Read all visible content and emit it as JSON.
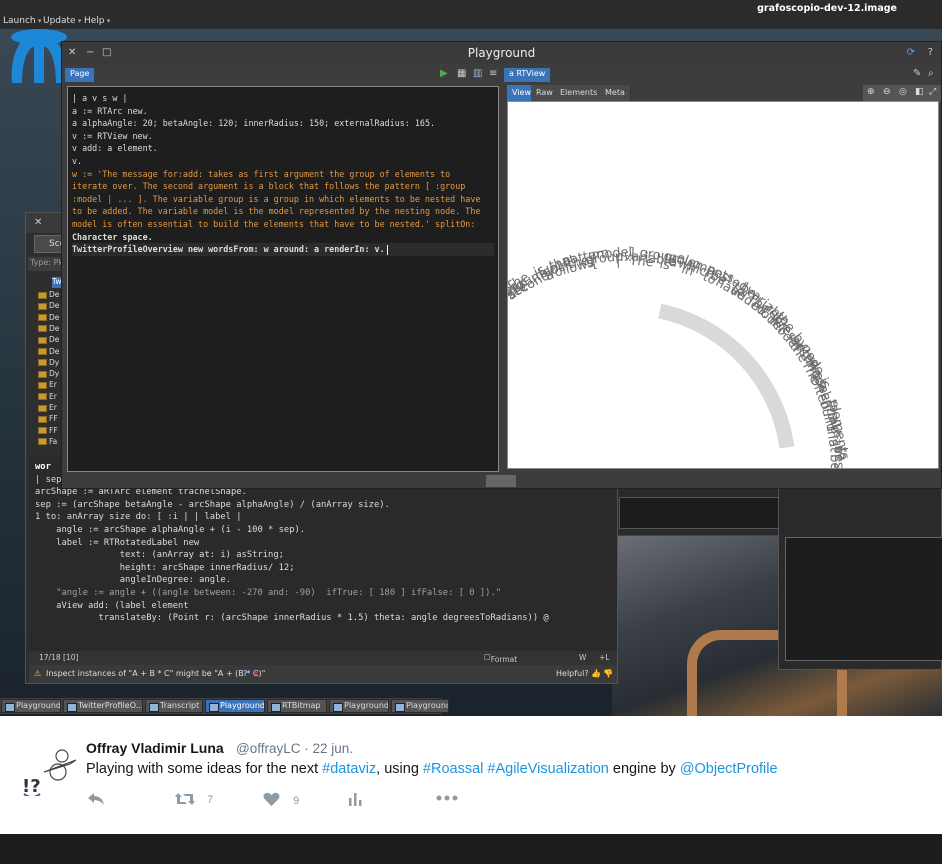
{
  "menubar": {
    "items": [
      "Launch",
      "Update",
      "Help"
    ],
    "image_name": "grafoscopio-dev-12.image"
  },
  "playground": {
    "title": "Playground",
    "left_tab": "Page",
    "right_tab": "a RTView",
    "view_tabs": [
      "View",
      "Raw",
      "Elements",
      "Meta"
    ],
    "code_lines": [
      "| a v s w |",
      "a := RTArc new.",
      "a alphaAngle: 20; betaAngle: 120; innerRadius: 150; externalRadius: 165.",
      "v := RTView new.",
      "v add: a element.",
      "v.",
      "w := 'The message for:add: takes as first argument the group of elements to",
      "iterate over. The second argument is a block that follows the pattern [ :group",
      ":model | ... ]. The variable group is a group in which elements to be nested have",
      "to be added. The variable model is the model represented by the nesting node. The",
      "model is often essential to build the elements that have to be nested.' splitOn:",
      "Character space.",
      "TwitterProfileOverview new wordsFrom: w around: a renderIn: v."
    ],
    "words": [
      "The",
      "message",
      "for:add:",
      "takes",
      "as",
      "first",
      "argument",
      "the",
      "group",
      "of",
      "elements",
      "to",
      "iterate",
      "over.",
      "The",
      "second",
      "argument",
      "is",
      "a",
      "block",
      "that",
      "follows",
      "the",
      "pattern",
      "[",
      ":group",
      ":model",
      "|",
      "...",
      "].",
      "The",
      "variable",
      "group",
      "is",
      "a",
      "group",
      "in",
      "which",
      "elements",
      "to",
      "be",
      "nested",
      "have",
      "to",
      "be",
      "added.",
      "The",
      "variable",
      "model",
      "is",
      "the",
      "model",
      "represented",
      "by",
      "the",
      "nesting",
      "node.",
      "The",
      "model",
      "is",
      "often",
      "essential",
      "to",
      "build",
      "the",
      "elements",
      "that",
      "have",
      "to",
      "be",
      "nested."
    ],
    "arc": {
      "alpha_angle": 20,
      "beta_angle": 120,
      "inner_radius": 150,
      "external_radius": 165
    }
  },
  "browser": {
    "scope_button": "Scop",
    "filter_placeholder": "Type: Pk",
    "selected_item": "Tw",
    "packages": [
      "De",
      "De",
      "De",
      "De",
      "De",
      "De",
      "Dy",
      "Dy",
      "Er",
      "Er",
      "Er",
      "FF",
      "FF",
      "Fa"
    ],
    "method_name": "wor",
    "code_lines": [
      "| sep arcShape angle |",
      "",
      "arcShape := aRTArc element trachelShape.",
      "sep := (arcShape betaAngle - arcShape alphaAngle) / (anArray size).",
      "1 to: anArray size do: [ :i | | label |",
      "    angle := arcShape alphaAngle + (i - 100 * sep).",
      "    label := RTRotatedLabel new",
      "                text: (anArray at: i) asString;",
      "                height: arcShape innerRadius/ 12;",
      "                angleInDegree: angle.",
      "    \"angle := angle + ((angle between: -270 and: -90)  ifTrue: [ 180 ] ifFalse: [ 0 ]).\"",
      "    aView add: (label element",
      "            translateBy: (Point r: (arcShape innerRadius * 1.5) theta: angle degreesToRadians)) @"
    ],
    "position": "17/18 [10]",
    "format_as_you_read": "Format as you read",
    "status_w": "W",
    "status_l": "+L",
    "hint_text": "Inspect instances of \"A + B * C\" might be \"A + (B * C)\"",
    "hint_help": "?",
    "helpful_label": "Helpful?"
  },
  "taskbar": {
    "items": [
      "Playground",
      "TwitterProfileO...",
      "Transcript",
      "Playground",
      "RTBitmap",
      "Playground",
      "Playground"
    ],
    "active_index": 3
  },
  "tweet": {
    "author": "Offray Vladimir Luna",
    "handle": "@offrayLC",
    "date": "22 jun.",
    "text_prefix": "Playing with some ideas for the next ",
    "hashtag1": "#dataviz",
    "text_mid": ", using ",
    "hashtag2": "#Roassal",
    "hashtag3": "#AgileVisualization",
    "text_mid2": " engine by ",
    "mention": "@ObjectProfile",
    "retweets": "7",
    "likes": "9"
  },
  "colors": {
    "accent": "#3b73b9",
    "link": "#1b95e0",
    "code_string": "#e49a44"
  }
}
